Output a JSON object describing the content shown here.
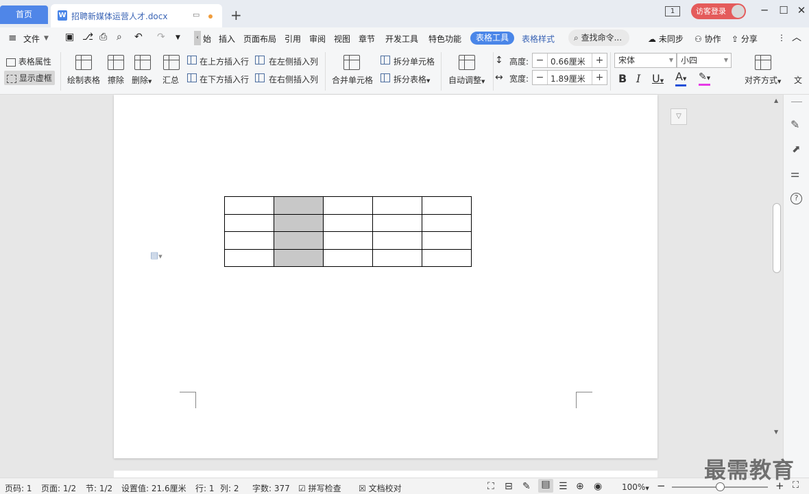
{
  "tabs": {
    "home": "首页",
    "doc_title": "招聘新媒体运营人才.docx",
    "new_tab": "+"
  },
  "title_right": {
    "page_icon": "1",
    "login": "访客登录"
  },
  "menu": {
    "file": "文件",
    "items": [
      "始",
      "插入",
      "页面布局",
      "引用",
      "审阅",
      "视图",
      "章节",
      "开发工具",
      "特色功能"
    ],
    "active": "表格工具",
    "table_style": "表格样式",
    "search": "查找命令...",
    "sync": "未同步",
    "collab": "协作",
    "share": "分享"
  },
  "ribbon": {
    "table_props": "表格属性",
    "show_grid": "显示虚框",
    "draw_table": "绘制表格",
    "erase": "擦除",
    "delete": "删除",
    "summary": "汇总",
    "insert_above": "在上方插入行",
    "insert_below": "在下方插入行",
    "insert_left": "在左侧插入列",
    "insert_right": "在右侧插入列",
    "merge": "合并单元格",
    "split_cells": "拆分单元格",
    "split_table": "拆分表格",
    "auto_fit": "自动调整",
    "height_label": "高度:",
    "height_value": "0.66厘米",
    "width_label": "宽度:",
    "width_value": "1.89厘米",
    "font": "宋体",
    "size": "小四",
    "bold": "B",
    "italic": "I",
    "underline": "U",
    "font_color": "A",
    "align": "对齐方式",
    "text_dir": "文"
  },
  "status": {
    "page_no": "页码: 1",
    "pages": "页面: 1/2",
    "section": "节: 1/2",
    "setting": "设置值: 21.6厘米",
    "row": "行: 1",
    "col": "列: 2",
    "words": "字数: 377",
    "spell": "拼写检查",
    "proof": "文档校对",
    "zoom": "100%"
  },
  "watermark": "最需教育"
}
